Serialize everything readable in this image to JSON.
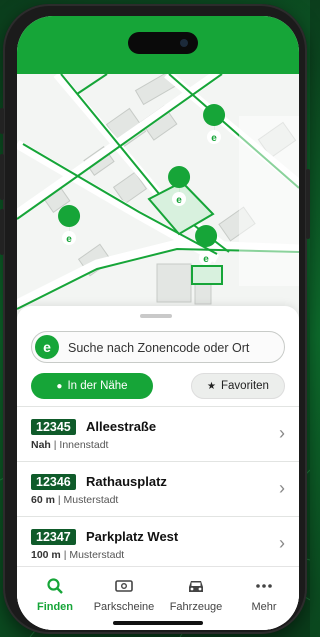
{
  "colors": {
    "brand_green": "#16a538",
    "code_badge": "#0f5b2a"
  },
  "map": {
    "pin_icon": "parking-pin-icon"
  },
  "search": {
    "placeholder": "Suche nach Zonencode oder Ort",
    "logo_letter": "e"
  },
  "filters": {
    "nearby_label": "In der Nähe",
    "favorites_label": "Favoriten"
  },
  "zones": [
    {
      "code": "12345",
      "name": "Alleestraße",
      "distance": "Nah",
      "city": "Innenstadt"
    },
    {
      "code": "12346",
      "name": "Rathausplatz",
      "distance": "60 m",
      "city": "Musterstadt"
    },
    {
      "code": "12347",
      "name": "Parkplatz West",
      "distance": "100 m",
      "city": "Musterstadt"
    }
  ],
  "nav": {
    "tabs": [
      {
        "label": "Finden",
        "icon": "search-icon",
        "active": true
      },
      {
        "label": "Parkscheine",
        "icon": "ticket-icon",
        "active": false
      },
      {
        "label": "Fahrzeuge",
        "icon": "car-icon",
        "active": false
      },
      {
        "label": "Mehr",
        "icon": "more-icon",
        "active": false
      }
    ]
  }
}
